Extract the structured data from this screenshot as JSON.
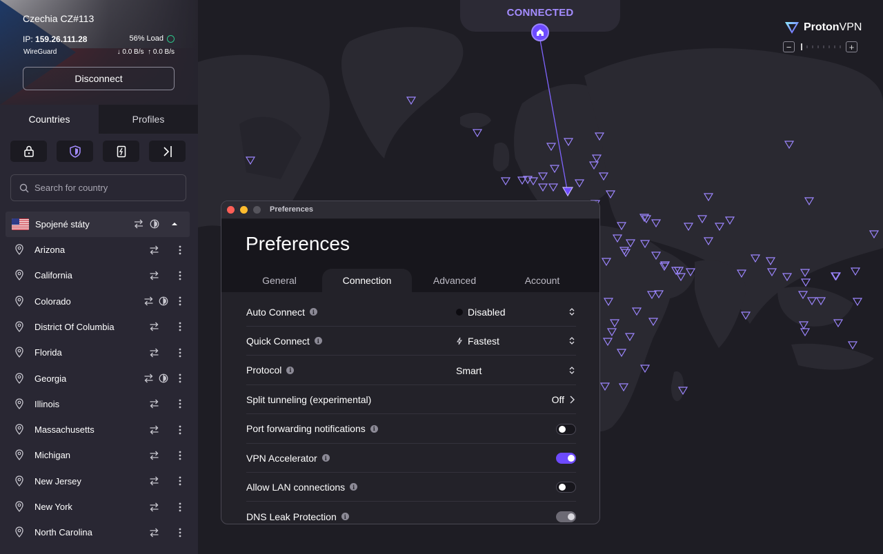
{
  "connection": {
    "server": "Czechia CZ#113",
    "ip_label": "IP:",
    "ip": "159.26.111.28",
    "load": "56% Load",
    "protocol": "WireGuard",
    "download": "0.0 B/s",
    "upload": "0.0 B/s",
    "disconnect_label": "Disconnect"
  },
  "sidebar": {
    "tabs": [
      {
        "label": "Countries",
        "active": true
      },
      {
        "label": "Profiles",
        "active": false
      }
    ],
    "quick_icons": [
      "lock-icon",
      "shield-icon",
      "card-icon",
      "sidebar-collapse-icon"
    ],
    "search_placeholder": "Search for country",
    "country": {
      "name": "Spojené státy",
      "flag": "us-flag"
    },
    "states": [
      {
        "name": "Arizona",
        "tor": false
      },
      {
        "name": "California",
        "tor": false
      },
      {
        "name": "Colorado",
        "tor": true
      },
      {
        "name": "District Of Columbia",
        "tor": false
      },
      {
        "name": "Florida",
        "tor": false
      },
      {
        "name": "Georgia",
        "tor": true
      },
      {
        "name": "Illinois",
        "tor": false
      },
      {
        "name": "Massachusetts",
        "tor": false
      },
      {
        "name": "Michigan",
        "tor": false
      },
      {
        "name": "New Jersey",
        "tor": false
      },
      {
        "name": "New York",
        "tor": false
      },
      {
        "name": "North Carolina",
        "tor": false
      }
    ]
  },
  "map": {
    "status": "CONNECTED",
    "brand_a": "Proton",
    "brand_b": "VPN",
    "accent": "#6d4aff",
    "status_color": "#a48cff"
  },
  "preferences": {
    "window_title": "Preferences",
    "heading": "Preferences",
    "tabs": [
      {
        "label": "General",
        "active": false
      },
      {
        "label": "Connection",
        "active": true
      },
      {
        "label": "Advanced",
        "active": false
      },
      {
        "label": "Account",
        "active": false
      }
    ],
    "settings": [
      {
        "label": "Auto Connect",
        "info": true,
        "kind": "select",
        "value": "Disabled",
        "lead": "dot"
      },
      {
        "label": "Quick Connect",
        "info": true,
        "kind": "select",
        "value": "Fastest",
        "lead": "bolt"
      },
      {
        "label": "Protocol",
        "info": true,
        "kind": "select",
        "value": "Smart",
        "lead": "none"
      },
      {
        "label": "Split tunneling (experimental)",
        "info": false,
        "kind": "link",
        "value": "Off"
      },
      {
        "label": "Port forwarding notifications",
        "info": true,
        "kind": "toggle",
        "state": "off"
      },
      {
        "label": "VPN Accelerator",
        "info": true,
        "kind": "toggle",
        "state": "on"
      },
      {
        "label": "Allow LAN connections",
        "info": true,
        "kind": "toggle",
        "state": "off"
      },
      {
        "label": "DNS Leak Protection",
        "info": true,
        "kind": "toggle",
        "state": "disabled"
      }
    ]
  }
}
